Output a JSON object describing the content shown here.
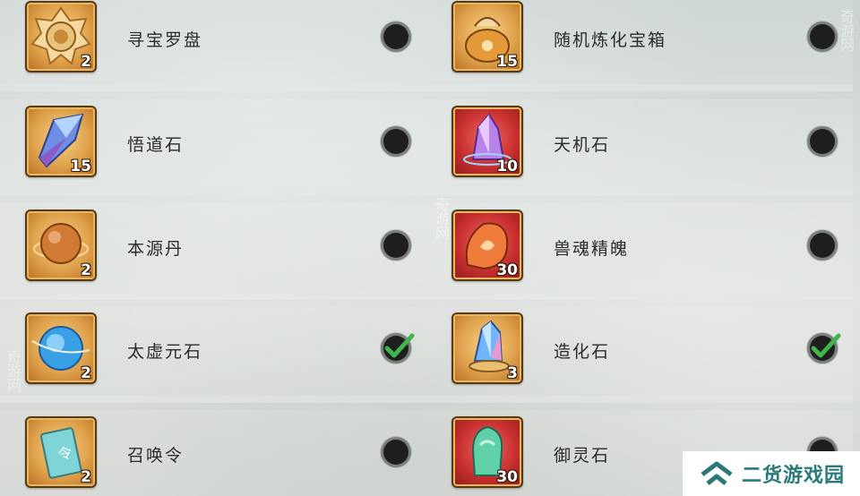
{
  "watermark": "奇游网",
  "brand": {
    "text": "二货游戏园",
    "color": "#2a7a7c"
  },
  "left_items": [
    {
      "name": "寻宝罗盘",
      "count": "2",
      "frame": "gold",
      "icon": "compass-icon",
      "checked": false
    },
    {
      "name": "悟道石",
      "count": "15",
      "frame": "gold",
      "icon": "blue-crystal-icon",
      "checked": false
    },
    {
      "name": "本源丹",
      "count": "2",
      "frame": "gold",
      "icon": "orange-pill-icon",
      "checked": false
    },
    {
      "name": "太虚元石",
      "count": "2",
      "frame": "gold",
      "icon": "blue-orb-icon",
      "checked": true
    },
    {
      "name": "召唤令",
      "count": "2",
      "frame": "gold",
      "icon": "summon-token-icon",
      "checked": false
    }
  ],
  "right_items": [
    {
      "name": "随机炼化宝箱",
      "count": "15",
      "frame": "gold",
      "icon": "treasure-bag-icon",
      "checked": false
    },
    {
      "name": "天机石",
      "count": "10",
      "frame": "red",
      "icon": "purple-crystal-icon",
      "checked": false
    },
    {
      "name": "兽魂精魄",
      "count": "30",
      "frame": "red",
      "icon": "beast-soul-icon",
      "checked": false
    },
    {
      "name": "造化石",
      "count": "3",
      "frame": "gold",
      "icon": "rainbow-crystal-icon",
      "checked": true
    },
    {
      "name": "御灵石",
      "count": "30",
      "frame": "red",
      "icon": "jade-stone-icon",
      "checked": false
    }
  ],
  "colors": {
    "checkmark": "#3fb54a",
    "radio": "#1e1e1e"
  }
}
